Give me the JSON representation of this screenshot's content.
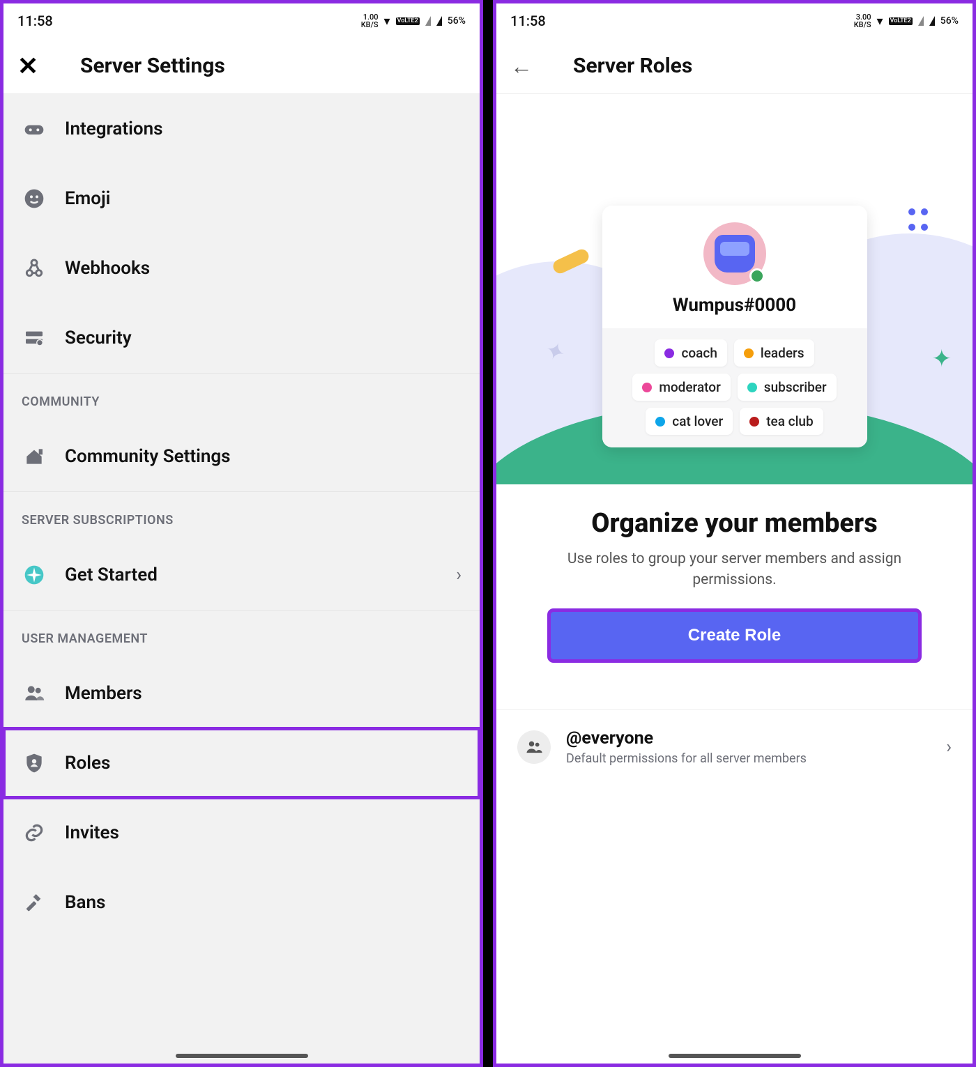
{
  "left": {
    "status": {
      "time": "11:58",
      "kbs_top": "1.00",
      "kbs_bot": "KB/S",
      "lte": "VoLTE2",
      "battery": "56%"
    },
    "appbar": {
      "title": "Server Settings"
    },
    "items_top": [
      {
        "icon": "gamepad-icon",
        "label": "Integrations"
      },
      {
        "icon": "emoji-icon",
        "label": "Emoji"
      },
      {
        "icon": "webhook-icon",
        "label": "Webhooks"
      },
      {
        "icon": "security-panel-icon",
        "label": "Security"
      }
    ],
    "section_community": "COMMUNITY",
    "community_item": {
      "label": "Community Settings"
    },
    "section_subs": "SERVER SUBSCRIPTIONS",
    "subs_item": {
      "label": "Get Started"
    },
    "section_user": "USER MANAGEMENT",
    "user_items": [
      {
        "icon": "members-icon",
        "label": "Members"
      },
      {
        "icon": "shield-person-icon",
        "label": "Roles",
        "hl": true
      },
      {
        "icon": "link-icon",
        "label": "Invites"
      },
      {
        "icon": "hammer-icon",
        "label": "Bans"
      }
    ]
  },
  "right": {
    "status": {
      "time": "11:58",
      "kbs_top": "3.00",
      "kbs_bot": "KB/S",
      "lte": "VoLTE2",
      "battery": "56%"
    },
    "appbar": {
      "title": "Server Roles"
    },
    "card": {
      "username": "Wumpus#0000",
      "chips": [
        {
          "color": "#8a2be2",
          "label": "coach"
        },
        {
          "color": "#f59e0b",
          "label": "leaders"
        },
        {
          "color": "#ec4899",
          "label": "moderator"
        },
        {
          "color": "#2dd4bf",
          "label": "subscriber"
        },
        {
          "color": "#0ea5e9",
          "label": "cat lover"
        },
        {
          "color": "#b91c1c",
          "label": "tea club"
        }
      ]
    },
    "promo": {
      "heading": "Organize your members",
      "sub": "Use roles to group your server members and assign permissions.",
      "cta": "Create Role"
    },
    "everyone": {
      "name": "@everyone",
      "sub": "Default permissions for all server members"
    }
  }
}
